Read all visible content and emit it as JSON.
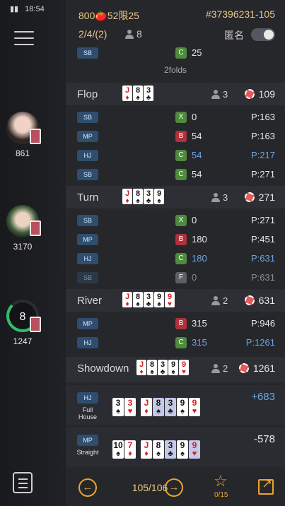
{
  "status": {
    "icon": "signal-icon",
    "time": "18:54"
  },
  "rail": {
    "players": [
      {
        "chips": "861"
      },
      {
        "chips": "3170"
      },
      {
        "chips": "1247",
        "seat": "8"
      }
    ]
  },
  "header": {
    "game_prefix": "800",
    "game_icon": "🍅",
    "game_suffix": "52限25",
    "hand_id": "#37396231-105",
    "round": "2/4/(2)",
    "players": "8",
    "anon_label": "匿名"
  },
  "preflop_tail": {
    "pos": "SB",
    "act": "C",
    "amount": "25"
  },
  "folds_text": "2folds",
  "flop": {
    "name": "Flop",
    "cards": [
      {
        "r": "J",
        "s": "♦",
        "c": "red"
      },
      {
        "r": "8",
        "s": "♠",
        "c": "black"
      },
      {
        "r": "3",
        "s": "♣",
        "c": "black"
      }
    ],
    "count": "3",
    "pot": "109",
    "rows": [
      {
        "pos": "SB",
        "act": "X",
        "amount": "0",
        "pot": "P:163"
      },
      {
        "pos": "MP",
        "act": "B",
        "amount": "54",
        "pot": "P:163"
      },
      {
        "pos": "HJ",
        "act": "C",
        "amount": "54",
        "pot": "P:217",
        "blue": true
      },
      {
        "pos": "SB",
        "act": "C",
        "amount": "54",
        "pot": "P:271"
      }
    ]
  },
  "turn": {
    "name": "Turn",
    "cards": [
      {
        "r": "J",
        "s": "♦",
        "c": "red"
      },
      {
        "r": "8",
        "s": "♠",
        "c": "black"
      },
      {
        "r": "3",
        "s": "♣",
        "c": "black"
      },
      {
        "r": "9",
        "s": "♠",
        "c": "black"
      }
    ],
    "count": "3",
    "pot": "271",
    "rows": [
      {
        "pos": "SB",
        "act": "X",
        "amount": "0",
        "pot": "P:271"
      },
      {
        "pos": "MP",
        "act": "B",
        "amount": "180",
        "pot": "P:451"
      },
      {
        "pos": "HJ",
        "act": "C",
        "amount": "180",
        "pot": "P:631",
        "blue": true
      },
      {
        "pos": "SB",
        "act": "F",
        "amount": "0",
        "pot": "P:631",
        "dim": true
      }
    ]
  },
  "river": {
    "name": "River",
    "cards": [
      {
        "r": "J",
        "s": "♦",
        "c": "red"
      },
      {
        "r": "8",
        "s": "♠",
        "c": "black"
      },
      {
        "r": "3",
        "s": "♣",
        "c": "black"
      },
      {
        "r": "9",
        "s": "♠",
        "c": "black"
      },
      {
        "r": "9",
        "s": "♥",
        "c": "red"
      }
    ],
    "count": "2",
    "pot": "631",
    "rows": [
      {
        "pos": "MP",
        "act": "B",
        "amount": "315",
        "pot": "P:946"
      },
      {
        "pos": "HJ",
        "act": "C",
        "amount": "315",
        "pot": "P:1261",
        "blue": true
      }
    ]
  },
  "showdown": {
    "name": "Showdown",
    "cards": [
      {
        "r": "J",
        "s": "♦",
        "c": "red"
      },
      {
        "r": "8",
        "s": "♠",
        "c": "black"
      },
      {
        "r": "3",
        "s": "♣",
        "c": "black"
      },
      {
        "r": "9",
        "s": "♠",
        "c": "black"
      },
      {
        "r": "9",
        "s": "♥",
        "c": "red"
      }
    ],
    "count": "2",
    "pot": "1261",
    "results": [
      {
        "pos": "HJ",
        "hand": "Full House",
        "delta": "+683",
        "win": true,
        "hole": [
          {
            "r": "3",
            "s": "♠",
            "c": "black"
          },
          {
            "r": "3",
            "s": "♥",
            "c": "red"
          }
        ],
        "best": [
          {
            "r": "J",
            "s": "♦",
            "c": "red"
          },
          {
            "r": "8",
            "s": "♠",
            "c": "black",
            "hl": true
          },
          {
            "r": "3",
            "s": "♣",
            "c": "black",
            "hl": true
          },
          {
            "r": "9",
            "s": "♠",
            "c": "black"
          },
          {
            "r": "9",
            "s": "♥",
            "c": "red"
          }
        ]
      },
      {
        "pos": "MP",
        "hand": "Straight",
        "delta": "-578",
        "win": false,
        "hole": [
          {
            "r": "10",
            "s": "♠",
            "c": "black"
          },
          {
            "r": "7",
            "s": "♦",
            "c": "red"
          }
        ],
        "best": [
          {
            "r": "J",
            "s": "♦",
            "c": "red"
          },
          {
            "r": "8",
            "s": "♠",
            "c": "black"
          },
          {
            "r": "3",
            "s": "♣",
            "c": "black",
            "hl": true
          },
          {
            "r": "9",
            "s": "♠",
            "c": "black"
          },
          {
            "r": "9",
            "s": "♥",
            "c": "red",
            "hl": true
          }
        ]
      }
    ]
  },
  "footer": {
    "prev_icon": "←",
    "page": "105/106",
    "next_icon": "→",
    "star_icon": "☆",
    "favorites": "0/15",
    "share_icon": "share-icon"
  },
  "colors": {
    "accent": "#e9a32f",
    "gold_text": "#e9c889",
    "blue_amount": "#6fa3e0",
    "bet": "#b0313a",
    "call": "#4f8b3d"
  }
}
